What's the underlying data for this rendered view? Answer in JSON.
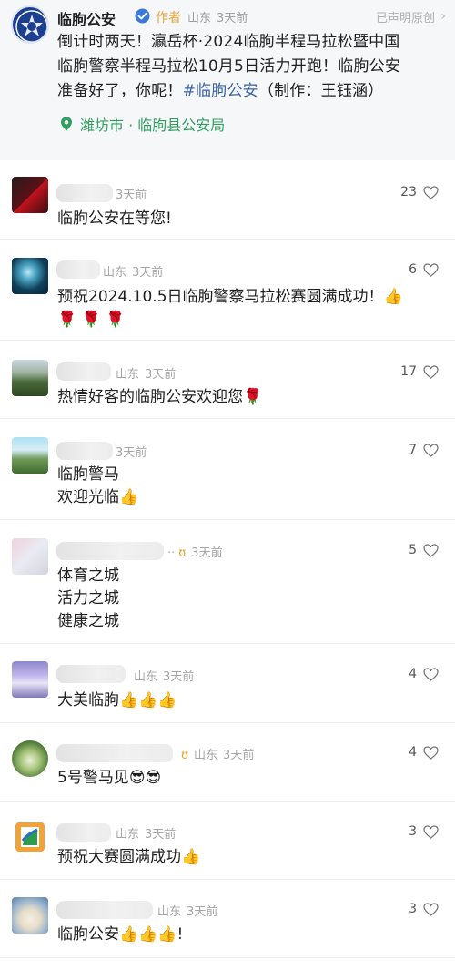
{
  "post": {
    "author": "临朐公安",
    "author_tag": "作者",
    "location_short": "山东",
    "time": "3天前",
    "original_claim": "已声明原创",
    "text_lines": [
      "倒计时两天！瀛岳杯·2024临朐半程马拉松暨中国",
      "临朐警察半程马拉松10月5日活力开跑！临朐公安",
      "准备好了，你呢！"
    ],
    "hashtag": "#临朐公安",
    "credit": "（制作：王钰涵）",
    "location": "潍坊市 · 临朐县公安局"
  },
  "comments": [
    {
      "region": "",
      "time": "3天前",
      "likes": "23",
      "lines": [
        "临朐公安在等您!"
      ]
    },
    {
      "region": "山东",
      "time": "3天前",
      "likes": "6",
      "lines": [
        "预祝2024.10.5日临朐警察马拉松赛圆满成功！👍",
        "🌹 🌹 🌹"
      ]
    },
    {
      "region": "山东",
      "time": "3天前",
      "likes": "17",
      "lines": [
        "热情好客的临朐公安欢迎您🌹"
      ]
    },
    {
      "region": "",
      "time": "3天前",
      "likes": "7",
      "lines": [
        "临朐警马",
        "欢迎光临👍"
      ]
    },
    {
      "region": "",
      "time": "3天前",
      "likes": "5",
      "lines": [
        "体育之城",
        "活力之城",
        "健康之城"
      ]
    },
    {
      "region": "山东",
      "time": "3天前",
      "likes": "4",
      "lines": [
        "大美临朐👍👍👍"
      ]
    },
    {
      "region": "山东",
      "time": "3天前",
      "likes": "4",
      "lines": [
        "5号警马见😎😎"
      ]
    },
    {
      "region": "山东",
      "time": "3天前",
      "likes": "3",
      "lines": [
        "预祝大赛圆满成功👍"
      ]
    },
    {
      "region": "山东",
      "time": "3天前",
      "likes": "3",
      "lines": [
        "临朐公安👍👍👍!"
      ]
    }
  ],
  "colors": {
    "like_text": "#555555",
    "location_green": "#2f9e5f",
    "hashtag_blue": "#3b63a8",
    "author_tag": "#e6a23c"
  },
  "icons": [
    "verified-icon",
    "chevron-right-icon",
    "location-pin-icon",
    "heart-icon",
    "badge-icon"
  ]
}
